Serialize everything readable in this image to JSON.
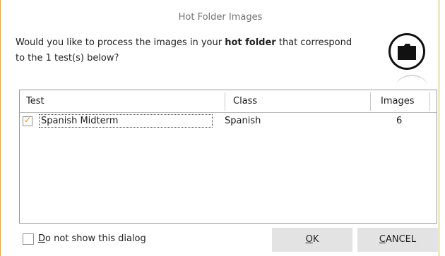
{
  "dialog": {
    "title": "Hot Folder Images",
    "message_line1_pre": "Would you like to process the images in your ",
    "message_bold": "hot folder",
    "message_line1_post": " that correspond",
    "message_line2": "to the 1 test(s) below?"
  },
  "table": {
    "columns": [
      "Test",
      "Class",
      "Images"
    ],
    "rows": [
      {
        "checked": true,
        "test": "Spanish Midterm",
        "class": "Spanish",
        "images": "6"
      }
    ]
  },
  "footer": {
    "dont_show_label_first": "D",
    "dont_show_label_rest": "o not show this dialog",
    "ok_first": "O",
    "ok_rest": "K",
    "cancel_first": "C",
    "cancel_rest": "ANCEL"
  },
  "icons": {
    "folder": "folder-icon",
    "checkmark": "checkmark-icon"
  },
  "colors": {
    "accent": "#e8a33a",
    "checkmark": "#e8890c",
    "button_bg": "#e3e3e3"
  }
}
